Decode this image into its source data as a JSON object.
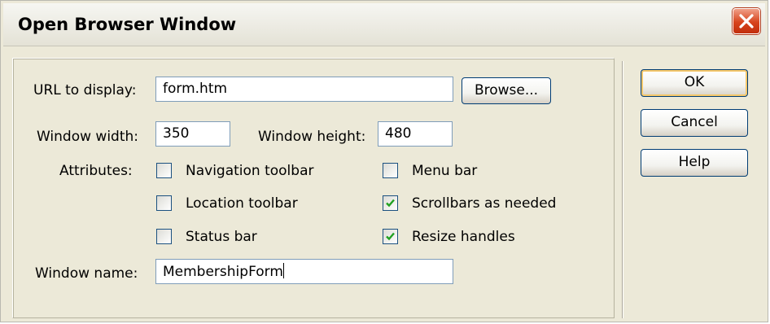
{
  "dialog": {
    "title": "Open Browser Window",
    "close_icon": "close-x-icon"
  },
  "form": {
    "url_label": "URL to display:",
    "url_value": "form.htm",
    "browse_label": "Browse...",
    "width_label": "Window width:",
    "width_value": "350",
    "height_label": "Window height:",
    "height_value": "480",
    "attributes_label": "Attributes:",
    "name_label": "Window name:",
    "name_value": "MembershipForm"
  },
  "attributes": {
    "navigation_toolbar": {
      "label": "Navigation toolbar",
      "checked": false
    },
    "location_toolbar": {
      "label": "Location toolbar",
      "checked": false
    },
    "status_bar": {
      "label": "Status bar",
      "checked": false
    },
    "menu_bar": {
      "label": "Menu bar",
      "checked": false
    },
    "scrollbars": {
      "label": "Scrollbars as needed",
      "checked": true
    },
    "resize_handles": {
      "label": "Resize handles",
      "checked": true
    }
  },
  "buttons": {
    "ok": "OK",
    "cancel": "Cancel",
    "help": "Help"
  },
  "colors": {
    "dialog_bg": "#ece9d8",
    "close_button": "#d7431c",
    "check_mark": "#21a121",
    "input_border": "#7f9db9",
    "default_button_highlight": "#f5c76a"
  }
}
